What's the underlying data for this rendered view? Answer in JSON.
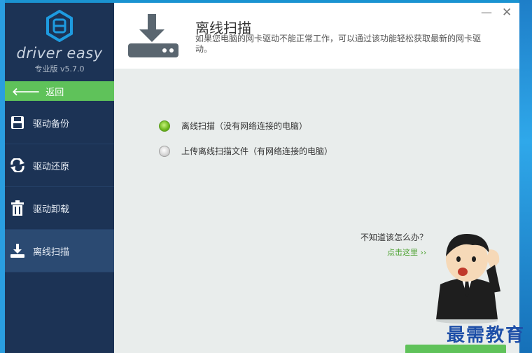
{
  "brand": {
    "name": "driver easy",
    "edition": "专业版 v5.7.0"
  },
  "sidebar": {
    "back_label": "返回",
    "items": [
      {
        "label": "驱动备份",
        "icon": "save-icon"
      },
      {
        "label": "驱动还原",
        "icon": "restore-icon"
      },
      {
        "label": "驱动卸载",
        "icon": "trash-icon"
      },
      {
        "label": "离线扫描",
        "icon": "download-icon"
      }
    ],
    "active_index": 3
  },
  "header": {
    "title": "离线扫描",
    "description": "如果您电脑的网卡驱动不能正常工作，可以通过该功能轻松获取最新的网卡驱动。",
    "minimize": "—",
    "close": "✕"
  },
  "options": [
    {
      "label": "离线扫描（没有网络连接的电脑）",
      "selected": true
    },
    {
      "label": "上传离线扫描文件（有网络连接的电脑）",
      "selected": false
    }
  ],
  "help": {
    "question": "不知道该怎么办？",
    "link": "点击这里 ››"
  },
  "watermark": "最需教育",
  "colors": {
    "sidebar": "#1c3355",
    "accent_green": "#5fc25a",
    "active_item": "#2b4a72"
  }
}
